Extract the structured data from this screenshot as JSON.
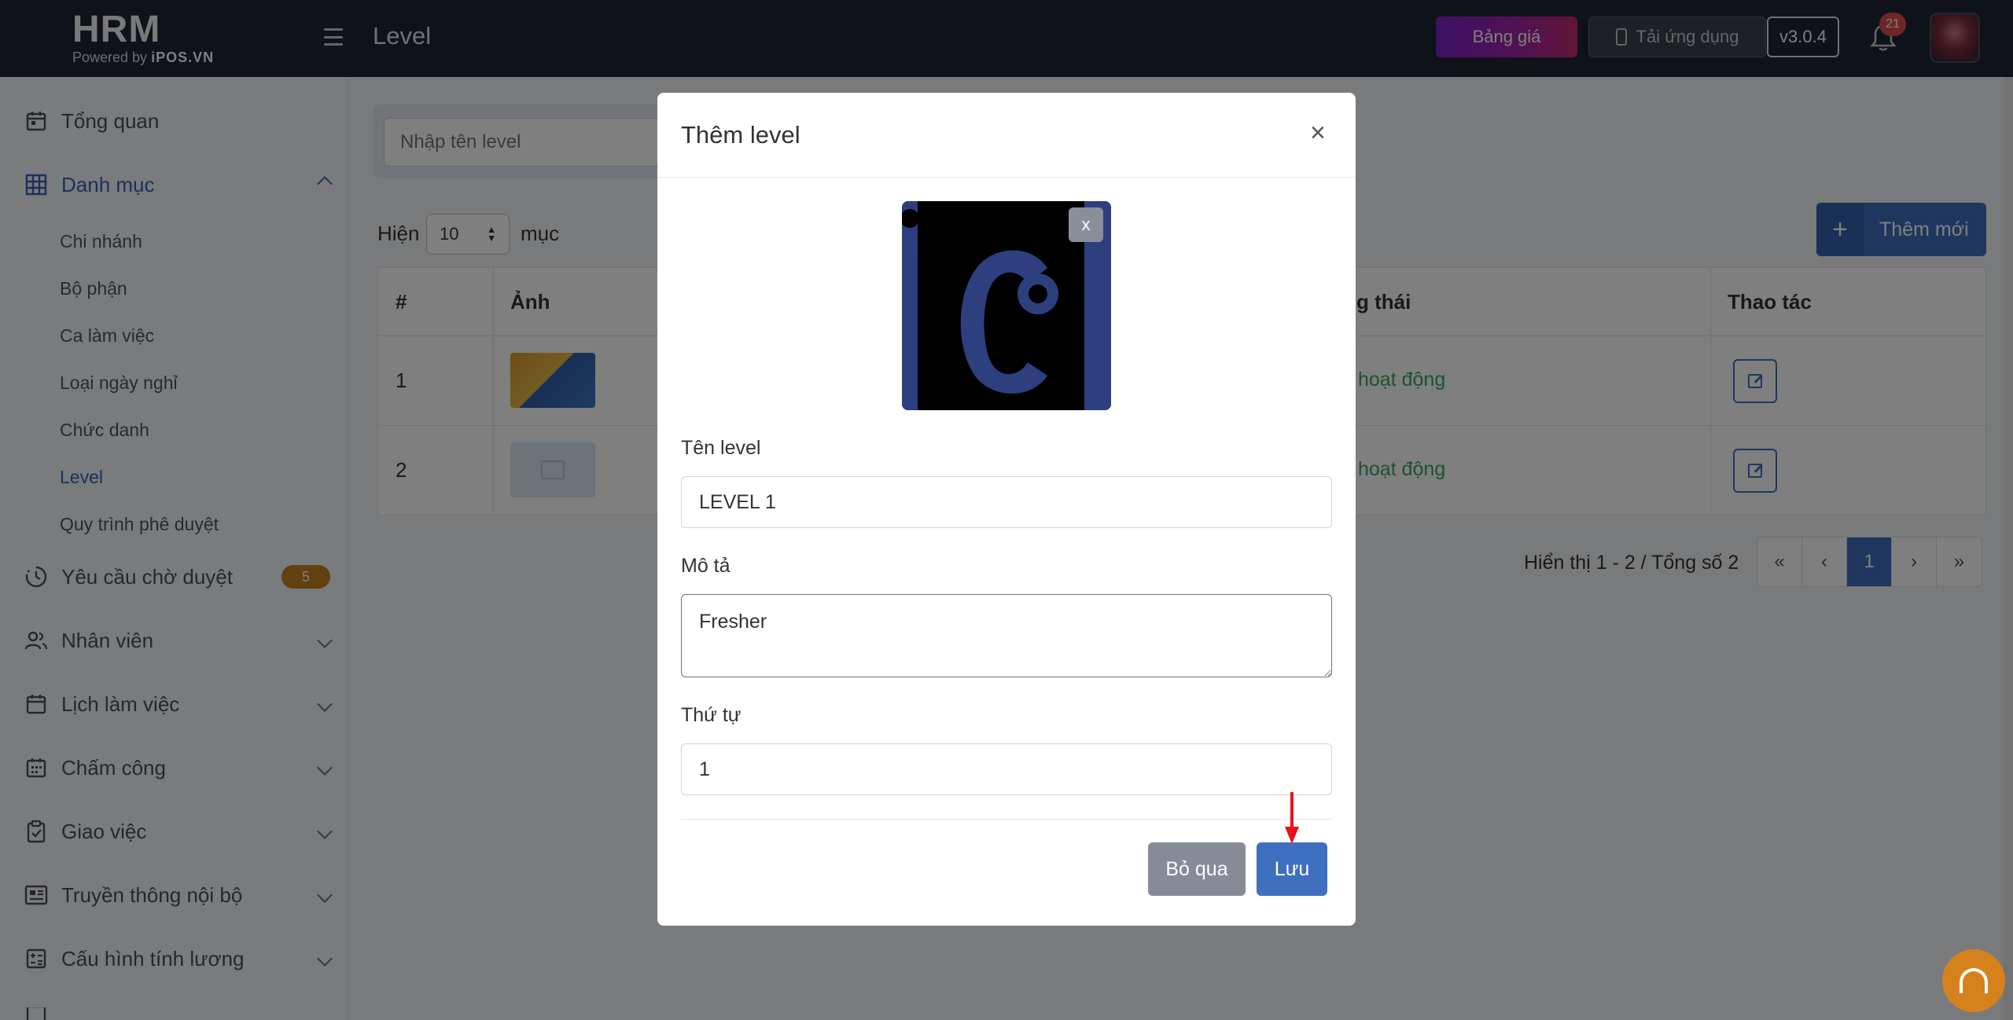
{
  "header": {
    "logo_main": "HRM",
    "logo_powered_prefix": "Powered by ",
    "logo_powered_brand": "iPOS.VN",
    "page_title": "Level",
    "pricing_label": "Bảng giá",
    "app_label": "Tải ứng dụng",
    "version": "v3.0.4",
    "notification_count": "21"
  },
  "sidebar": {
    "overview": "Tổng quan",
    "catalog": "Danh mục",
    "catalog_items": [
      "Chi nhánh",
      "Bộ phận",
      "Ca làm việc",
      "Loại ngày nghỉ",
      "Chức danh",
      "Level",
      "Quy trình phê duyệt"
    ],
    "active_sub_item": "Level",
    "pending": "Yêu cầu chờ duyệt",
    "pending_count": "5",
    "employees": "Nhân viên",
    "schedule": "Lịch làm việc",
    "attendance": "Chấm công",
    "tasks": "Giao việc",
    "internal_comms": "Truyền thông nội bộ",
    "payroll_config": "Cấu hình tính lương"
  },
  "main": {
    "search_placeholder": "Nhập tên level",
    "show_label": "Hiện",
    "page_size": "10",
    "entries_label": "mục",
    "add_button": "Thêm mới",
    "table": {
      "headers": [
        "#",
        "Ảnh",
        "g thái",
        "Thao tác"
      ],
      "rows": [
        {
          "index": "1",
          "status": "hoạt động"
        },
        {
          "index": "2",
          "status": "hoạt động"
        }
      ]
    },
    "pagination_info": "Hiển thị 1 - 2 / Tổng số 2",
    "pagination": {
      "first": "«",
      "prev": "‹",
      "current": "1",
      "next": "›",
      "last": "»"
    }
  },
  "modal": {
    "title": "Thêm level",
    "close": "×",
    "remove_image": "x",
    "name_label": "Tên level",
    "name_value": "LEVEL 1",
    "description_label": "Mô tả",
    "description_value": "Fresher",
    "order_label": "Thứ tự",
    "order_value": "1",
    "cancel_button": "Bỏ qua",
    "save_button": "Lưu"
  },
  "colors": {
    "primary": "#3f6fbf",
    "header_bg": "#1f2533",
    "status_green": "#3aa35e",
    "badge_orange": "#c4801e",
    "annotation_arrow": "#e8121c"
  }
}
